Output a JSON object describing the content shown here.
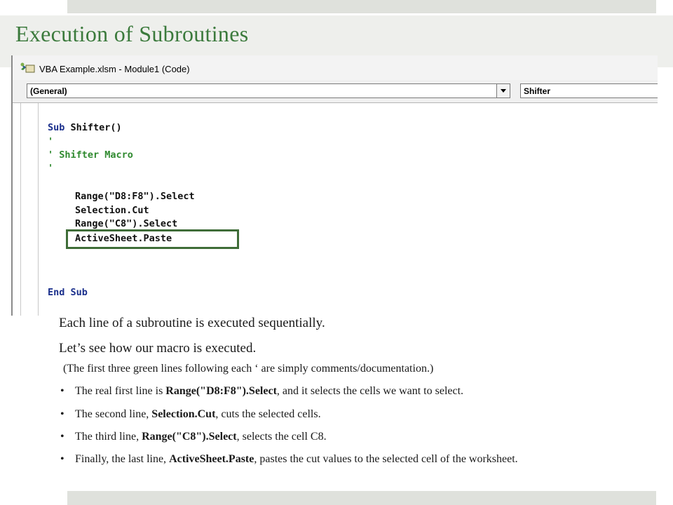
{
  "slide": {
    "title": "Execution of Subroutines"
  },
  "vba": {
    "window_title": "VBA Example.xlsm - Module1 (Code)",
    "object_combo": "(General)",
    "procedure_combo": "Shifter",
    "code": {
      "line_sub_kw": "Sub",
      "line_sub_name": " Shifter()",
      "comment_1": "'",
      "comment_2": "' Shifter Macro",
      "comment_3": "'",
      "stmt_1": "Range(\"D8:F8\").Select",
      "stmt_2": "Selection.Cut",
      "stmt_3": "Range(\"C8\").Select",
      "stmt_4": "ActiveSheet.Paste",
      "end_sub": "End Sub"
    },
    "highlight_color": "#3f6d38"
  },
  "text": {
    "line1": "Each line of a subroutine is executed sequentially.",
    "line2": "Let’s see how our macro is executed.",
    "note": "(The first three green lines following each ‘ are  simply comments/documentation.)",
    "bullets": [
      {
        "pre": "The real first line is ",
        "bold": "Range(\"D8:F8\").Select",
        "post": ", and it selects the cells we want to select."
      },
      {
        "pre": "The second line, ",
        "bold": "Selection.Cut",
        "post": ", cuts the selected cells."
      },
      {
        "pre": "The third line, ",
        "bold": "Range(\"C8\").Select",
        "post": ", selects the cell C8."
      },
      {
        "pre": "Finally, the last line, ",
        "bold": "ActiveSheet.Paste",
        "post": ", pastes the cut values to the selected cell of the worksheet."
      }
    ],
    "bullet_glyph": "•"
  },
  "colors": {
    "title_green": "#3b7a3c",
    "keyword_blue": "#1a2f8c",
    "comment_green": "#2f8a2f"
  }
}
